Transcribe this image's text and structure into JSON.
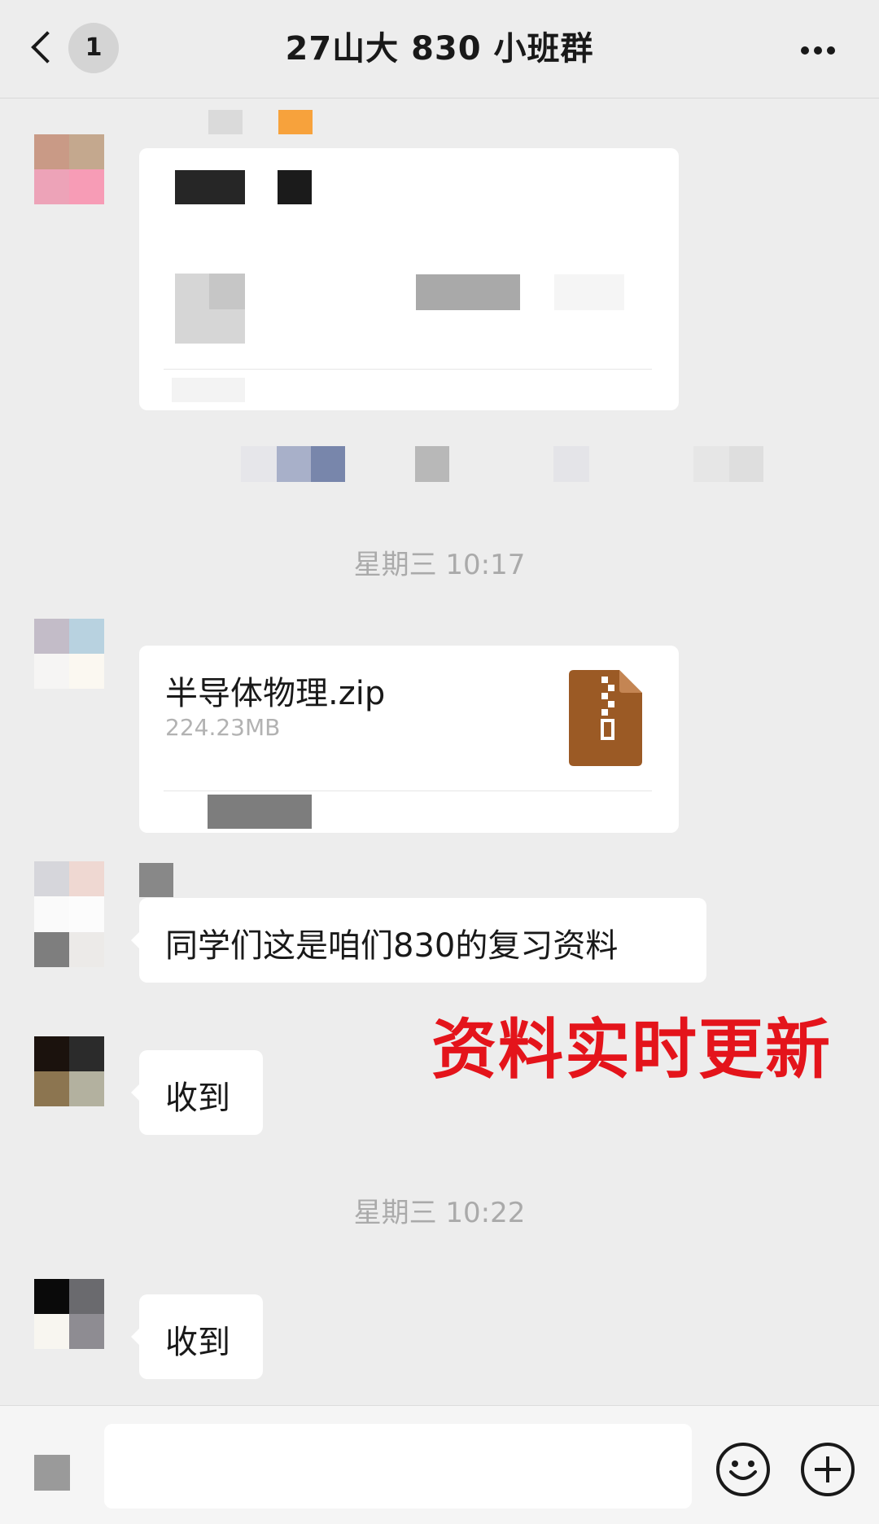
{
  "header": {
    "unread_count": "1",
    "title": "27山大 830 小班群"
  },
  "timestamps": [
    "星期三 10:17",
    "星期三 10:22"
  ],
  "file_message": {
    "file_name": "半导体物理.zip",
    "file_size": "224.23MB",
    "icon": "zip-file-icon",
    "icon_color": "#9b5a25"
  },
  "messages": [
    {
      "text": "同学们这是咱们830的复习资料"
    },
    {
      "text": "收到"
    },
    {
      "text": "收到"
    }
  ],
  "overlay_text": "资料实时更新",
  "overlay_color": "#e4141b",
  "input_bar": {
    "icons": [
      "voice-icon",
      "emoji-icon",
      "plus-icon"
    ]
  }
}
